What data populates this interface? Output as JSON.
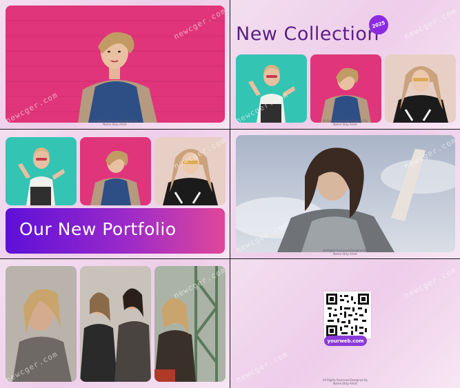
{
  "watermark": "newcger.com",
  "credit_line1": "All Rights Reserved Designed By",
  "credit_line2": "Name Strip Artist",
  "panel2": {
    "title": "New Collection",
    "badge": "2025"
  },
  "panel3": {
    "banner": "Our New Portfolio"
  },
  "panel6": {
    "url": "yourweb.com"
  },
  "colors": {
    "accent": "#8a2be2",
    "title": "#5b1e86",
    "pink_wall": "#e23a7c",
    "teal": "#2fc4b2"
  }
}
